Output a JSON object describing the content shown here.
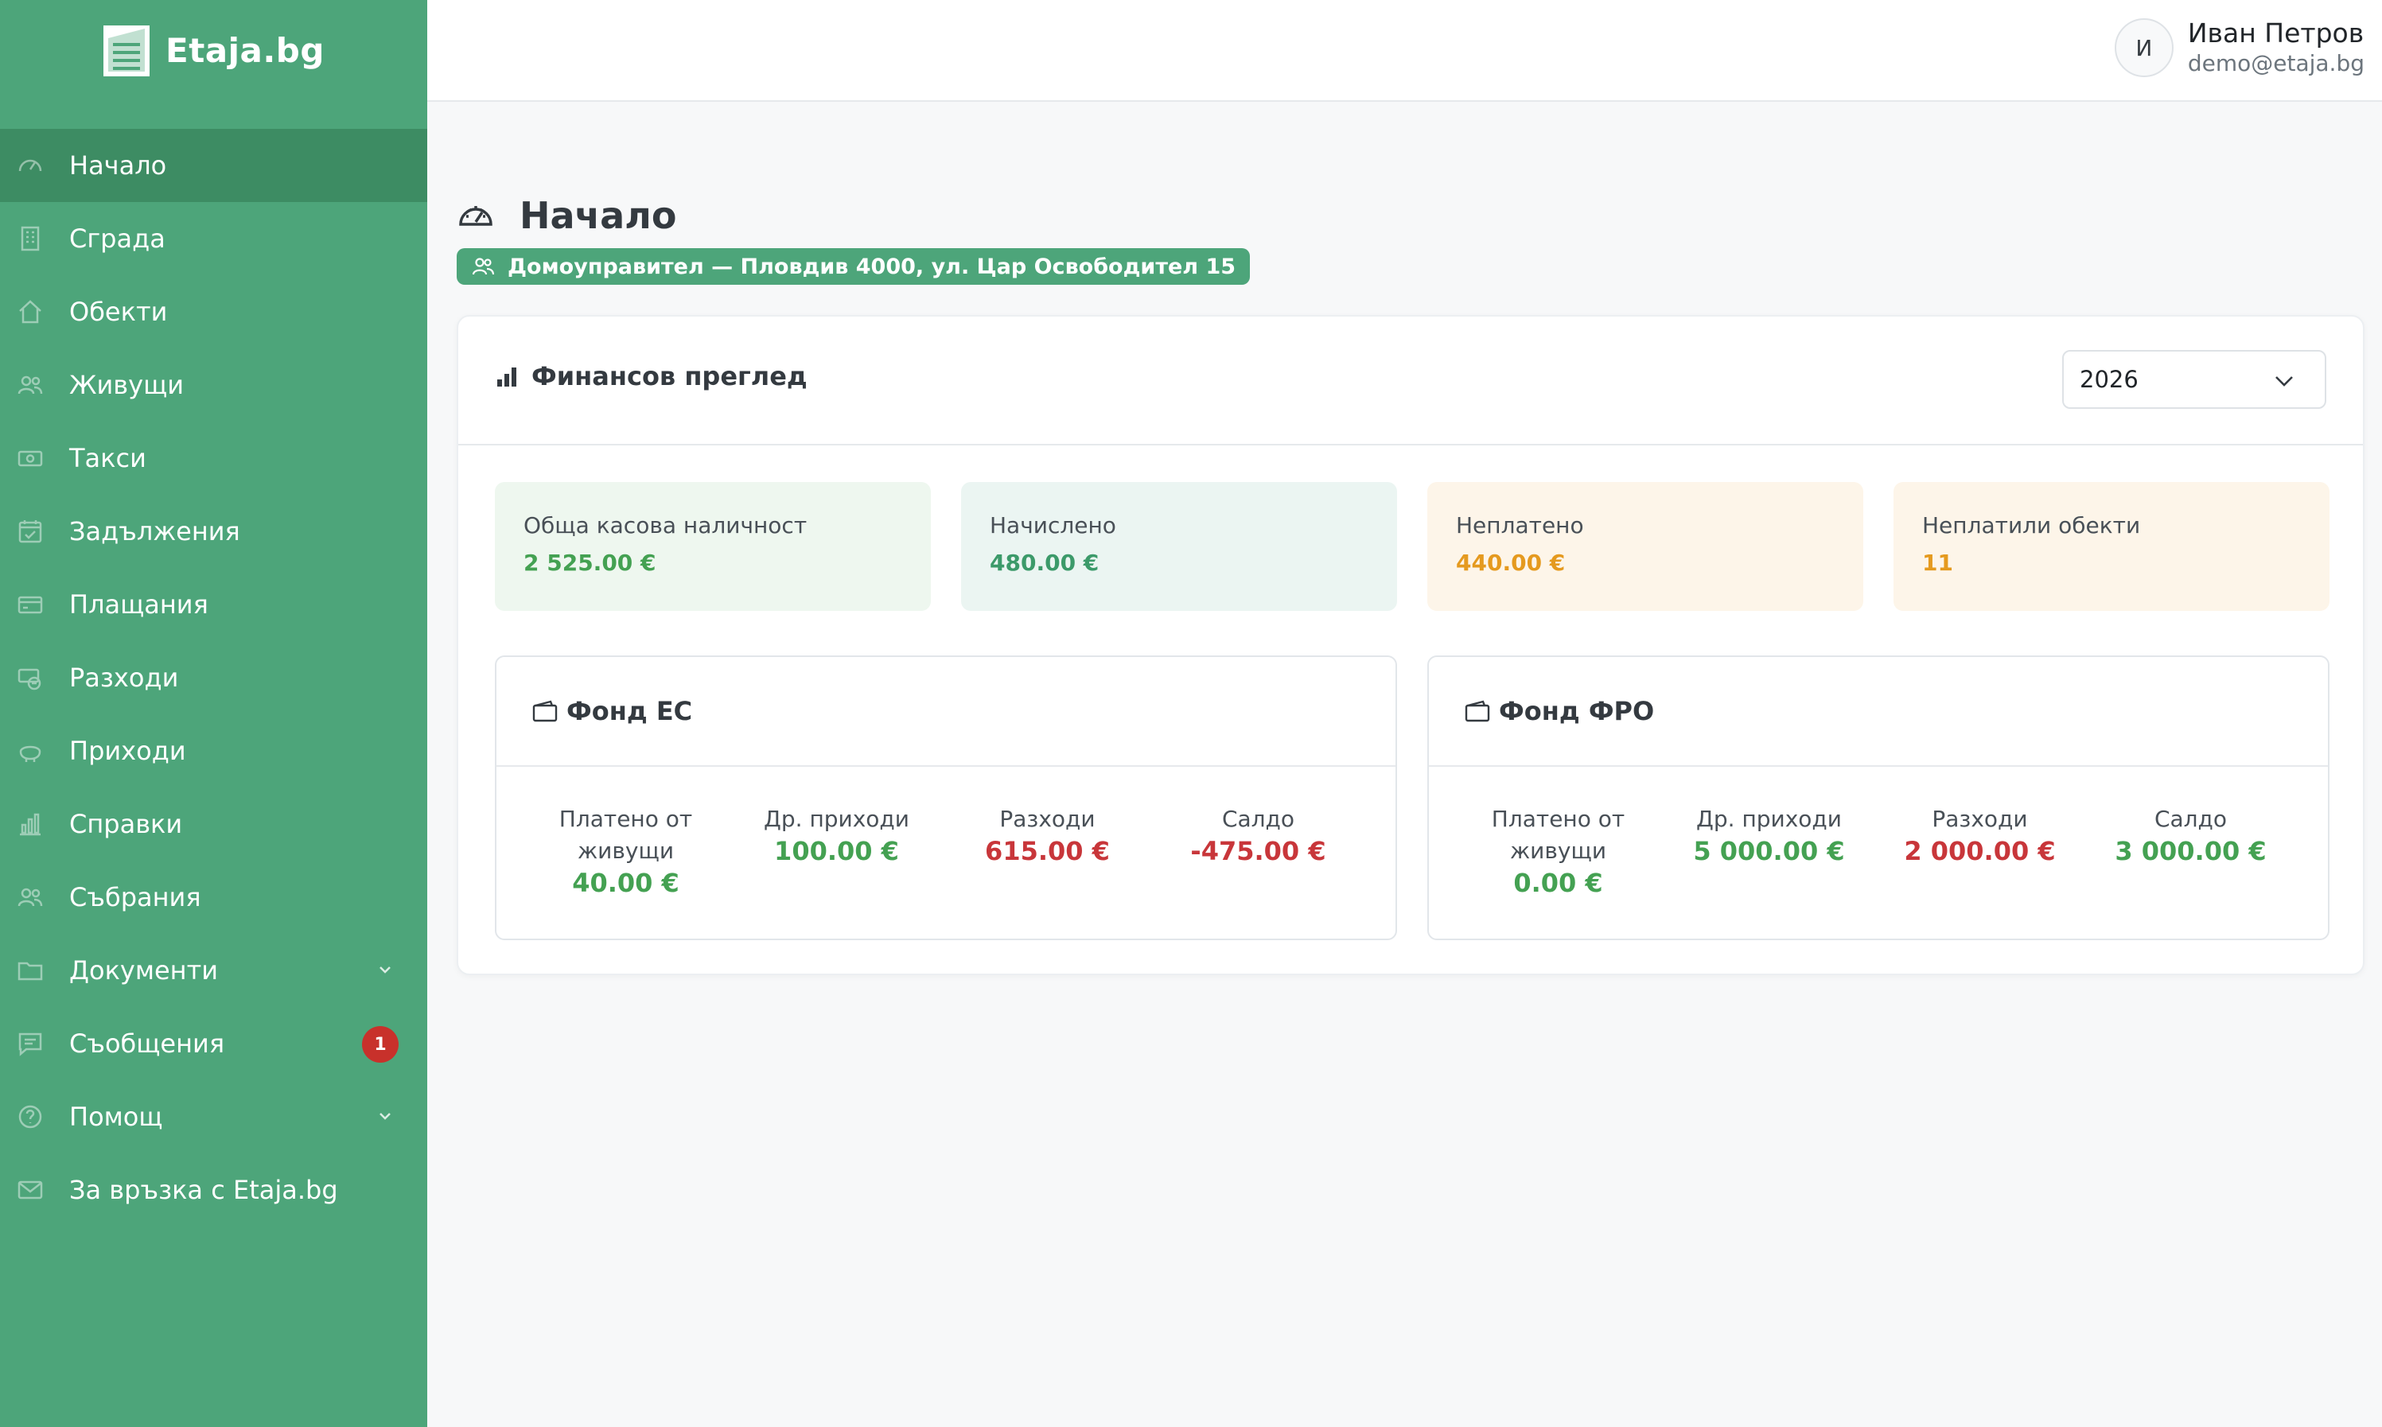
{
  "brand": {
    "name": "Etaja.bg"
  },
  "sidebar": {
    "items": [
      {
        "label": "Начало",
        "icon": "gauge-icon"
      },
      {
        "label": "Сграда",
        "icon": "building-icon"
      },
      {
        "label": "Обекти",
        "icon": "house-icon"
      },
      {
        "label": "Живущи",
        "icon": "people-icon"
      },
      {
        "label": "Такси",
        "icon": "cash-icon"
      },
      {
        "label": "Задължения",
        "icon": "calendar-check-icon"
      },
      {
        "label": "Плащания",
        "icon": "credit-card-icon"
      },
      {
        "label": "Разходи",
        "icon": "cash-out-icon"
      },
      {
        "label": "Приходи",
        "icon": "piggy-bank-icon"
      },
      {
        "label": "Справки",
        "icon": "bar-chart-icon"
      },
      {
        "label": "Събрания",
        "icon": "people-icon"
      },
      {
        "label": "Документи",
        "icon": "folder-icon"
      },
      {
        "label": "Съобщения",
        "icon": "chat-icon",
        "badge": "1"
      },
      {
        "label": "Помощ",
        "icon": "question-circle-icon"
      },
      {
        "label": "За връзка с Etaja.bg",
        "icon": "envelope-icon"
      }
    ]
  },
  "user": {
    "initial": "И",
    "name": "Иван Петров",
    "email": "demo@etaja.bg"
  },
  "page": {
    "title": "Начало",
    "role": "Домоуправител — Пловдив 4000, ул. Цар Освободител 15"
  },
  "finance": {
    "title": "Финансов преглед",
    "year": "2026",
    "stats": [
      {
        "label": "Обща касова наличност",
        "value": "2 525.00 €",
        "color": "#44a152"
      },
      {
        "label": "Начислено",
        "value": "480.00 €",
        "color": "#3c9a6a"
      },
      {
        "label": "Неплатено",
        "value": "440.00 €",
        "color": "#e59a1f"
      },
      {
        "label": "Неплатили обекти",
        "value": "11",
        "color": "#e59a1f"
      }
    ],
    "funds": [
      {
        "name": "Фонд ЕС",
        "paid_label": "Платено от живущи",
        "paid": "40.00 €",
        "other_label": "Др. приходи",
        "other": "100.00 €",
        "expenses_label": "Разходи",
        "expenses": "615.00 €",
        "balance_label": "Салдо",
        "balance": "-475.00 €"
      },
      {
        "name": "Фонд ФРО",
        "paid_label": "Платено от живущи",
        "paid": "0.00 €",
        "other_label": "Др. приходи",
        "other": "5 000.00 €",
        "expenses_label": "Разходи",
        "expenses": "2 000.00 €",
        "balance_label": "Салдо",
        "balance": "3 000.00 €"
      }
    ]
  }
}
